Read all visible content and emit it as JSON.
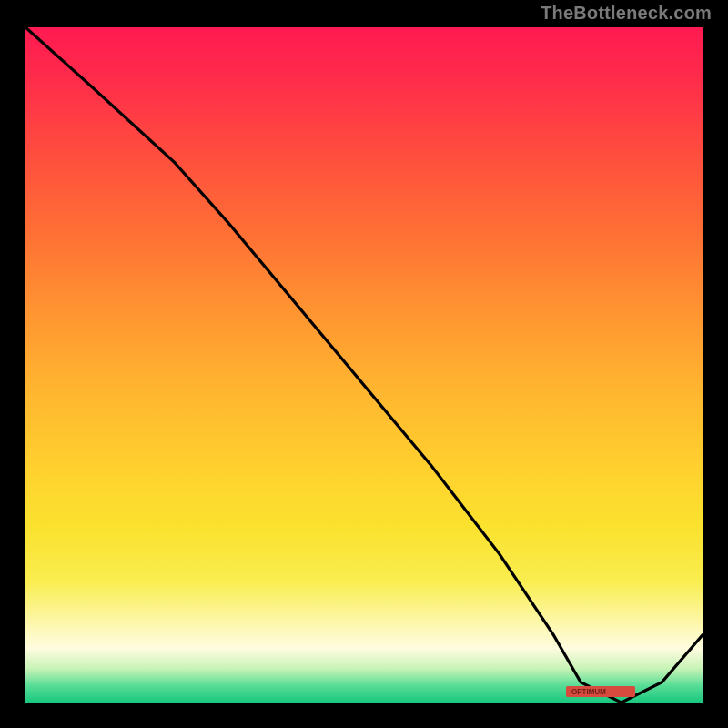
{
  "watermark": "TheBottleneck.com",
  "chart_data": {
    "type": "line",
    "title": "",
    "xlabel": "",
    "ylabel": "",
    "xlim": [
      0,
      100
    ],
    "ylim": [
      0,
      100
    ],
    "grid": false,
    "series": [
      {
        "name": "bottleneck-curve",
        "x": [
          0,
          10,
          22,
          30,
          40,
          50,
          60,
          70,
          78,
          82,
          88,
          94,
          100
        ],
        "y": [
          100,
          91,
          80,
          71,
          59,
          47,
          35,
          22,
          10,
          3,
          0,
          3,
          10
        ]
      }
    ],
    "annotations": [
      {
        "name": "min-plateau-label",
        "x": 85,
        "y": 0,
        "text": "OPTIMUM"
      }
    ],
    "background_gradient": {
      "orientation": "vertical",
      "stops": [
        {
          "pos": 0.0,
          "color": "#ff1a51"
        },
        {
          "pos": 0.3,
          "color": "#ff6e35"
        },
        {
          "pos": 0.66,
          "color": "#ffd22e"
        },
        {
          "pos": 0.92,
          "color": "#fffce0"
        },
        {
          "pos": 1.0,
          "color": "#19c880"
        }
      ]
    }
  }
}
